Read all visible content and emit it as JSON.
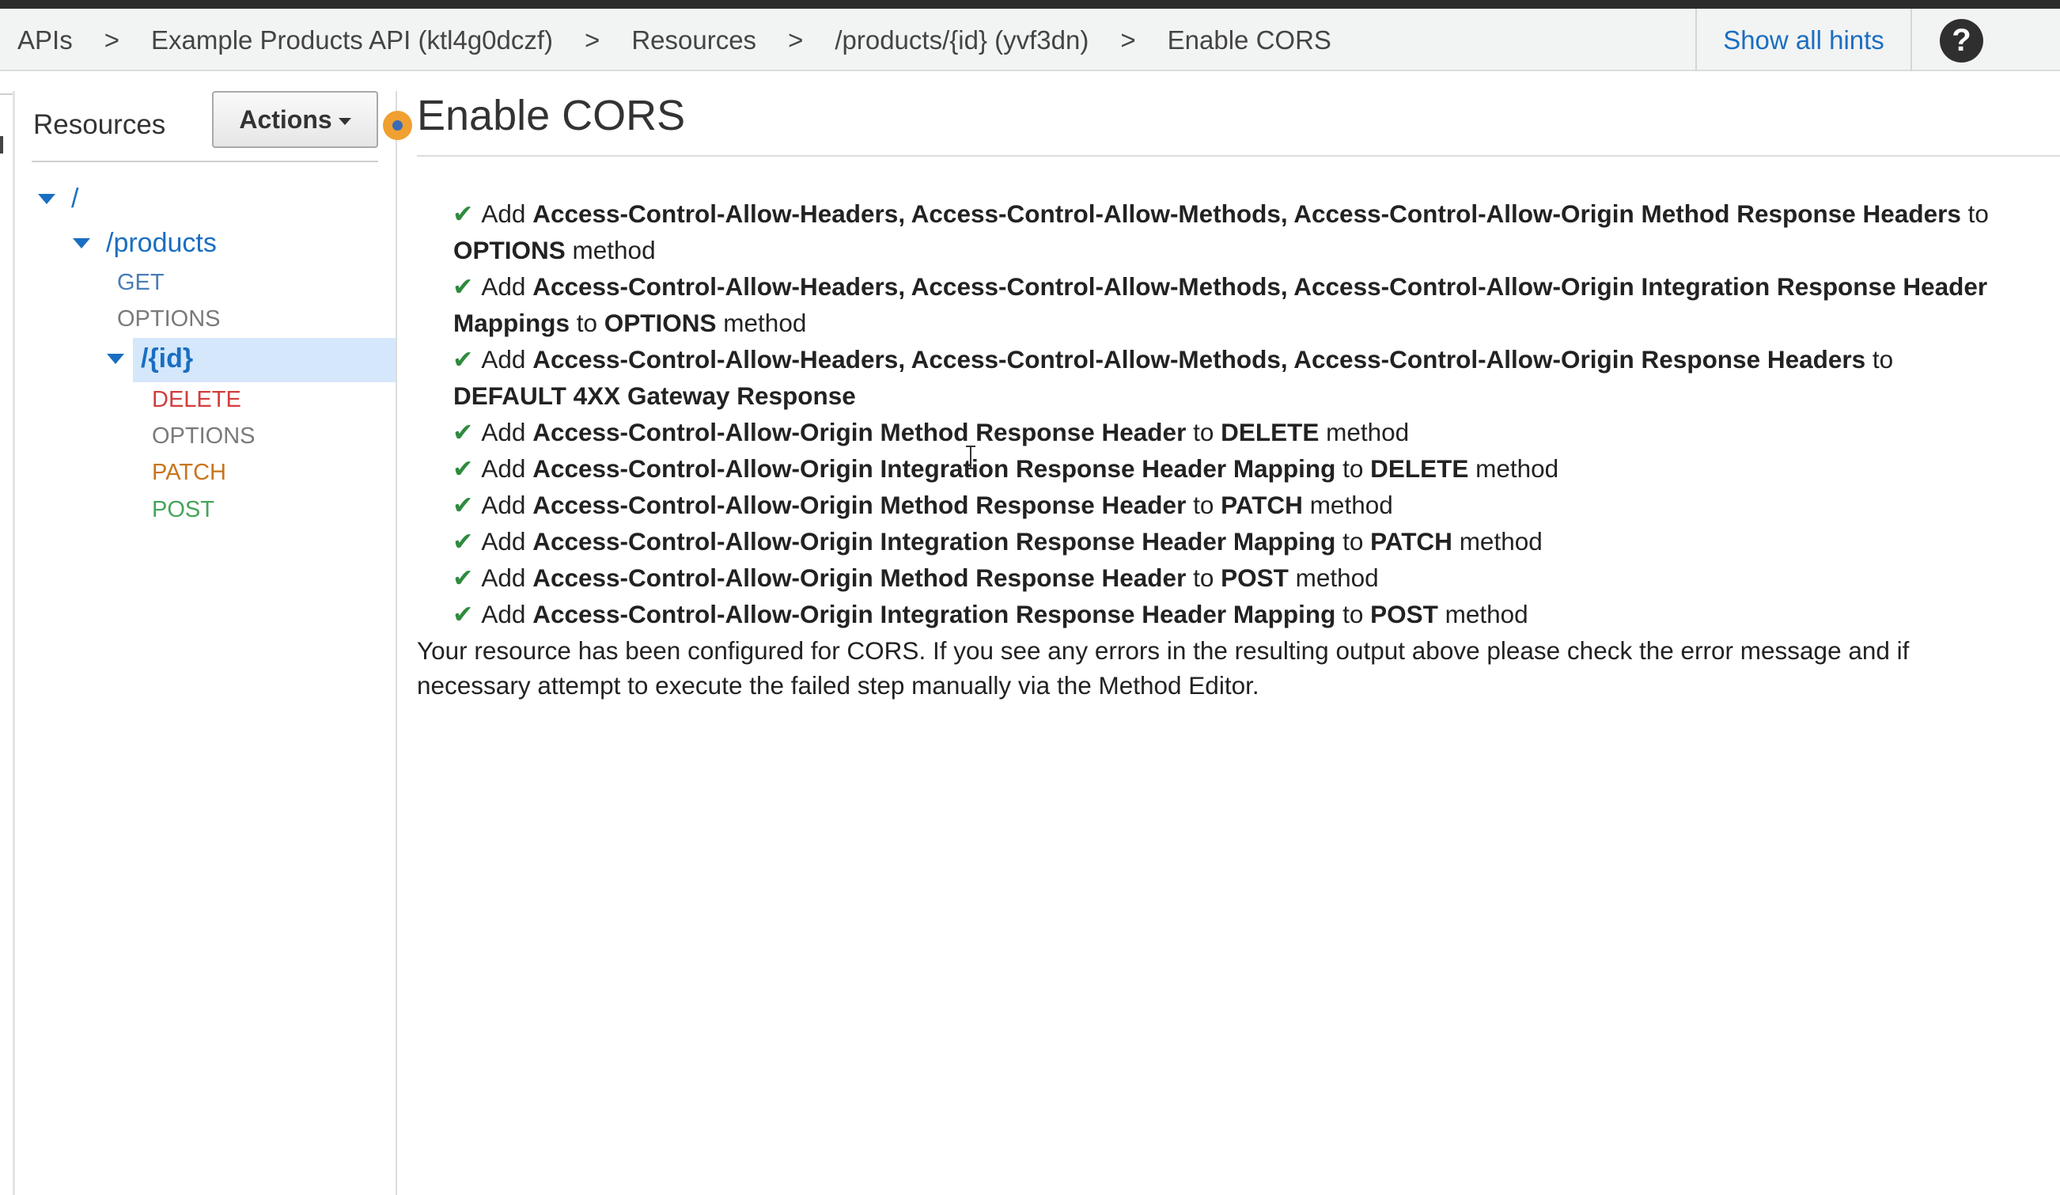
{
  "breadcrumb": {
    "items": [
      "APIs",
      "Example Products API (ktl4g0dczf)",
      "Resources",
      "/products/{id} (yvf3dn)",
      "Enable CORS"
    ],
    "separator": ">"
  },
  "header": {
    "hints_label": "Show all hints",
    "help_label": "?"
  },
  "sidebar": {
    "title": "Resources",
    "actions_label": "Actions",
    "tree": {
      "root": "/",
      "products": "/products",
      "products_methods": [
        "GET",
        "OPTIONS"
      ],
      "id": "/{id}",
      "id_methods": [
        "DELETE",
        "OPTIONS",
        "PATCH",
        "POST"
      ]
    }
  },
  "main": {
    "title": "Enable CORS",
    "log": {
      "l0": {
        "a": "Add ",
        "b": "Access-Control-Allow-Headers, Access-Control-Allow-Methods, Access-Control-Allow-Origin Method Response Headers",
        "c": " to"
      },
      "l0c": {
        "a": "OPTIONS",
        "b": " method"
      },
      "l1": {
        "a": "Add ",
        "b": "Access-Control-Allow-Headers, Access-Control-Allow-Methods, Access-Control-Allow-Origin Integration Response Header"
      },
      "l1c": {
        "a": "Mappings",
        "b": " to ",
        "c": "OPTIONS",
        "d": " method"
      },
      "l2": {
        "a": "Add ",
        "b": "Access-Control-Allow-Headers, Access-Control-Allow-Methods, Access-Control-Allow-Origin Response Headers",
        "c": " to"
      },
      "l2c": {
        "a": "DEFAULT 4XX Gateway Response"
      },
      "l3": {
        "a": "Add ",
        "b": "Access-Control-Allow-Origin Method Response Header",
        "c": " to ",
        "d": "DELETE",
        "e": " method"
      },
      "l4": {
        "a": "Add ",
        "b": "Access-Control-Allow-Origin Integration Response Header Mapping",
        "c": " to ",
        "d": "DELETE",
        "e": " method"
      },
      "l5": {
        "a": "Add ",
        "b": "Access-Control-Allow-Origin Method Response Header",
        "c": " to ",
        "d": "PATCH",
        "e": " method"
      },
      "l6": {
        "a": "Add ",
        "b": "Access-Control-Allow-Origin Integration Response Header Mapping",
        "c": " to ",
        "d": "PATCH",
        "e": " method"
      },
      "l7": {
        "a": "Add ",
        "b": "Access-Control-Allow-Origin Method Response Header",
        "c": " to ",
        "d": "POST",
        "e": " method"
      },
      "l8": {
        "a": "Add ",
        "b": "Access-Control-Allow-Origin Integration Response Header Mapping",
        "c": " to ",
        "d": "POST",
        "e": " method"
      }
    },
    "check_glyph": "✔",
    "summary_line1": "Your resource has been configured for CORS. If you see any errors in the resulting output above please check the error message and if",
    "summary_line2": "necessary attempt to execute the failed step manually via the Method Editor."
  },
  "colors": {
    "link_blue": "#1a6ec1",
    "check_green": "#2e8b3e",
    "delete_red": "#d33c3c",
    "patch_orange": "#c8741c",
    "post_green": "#46a45a",
    "selected_bg": "#d5e7fb"
  }
}
